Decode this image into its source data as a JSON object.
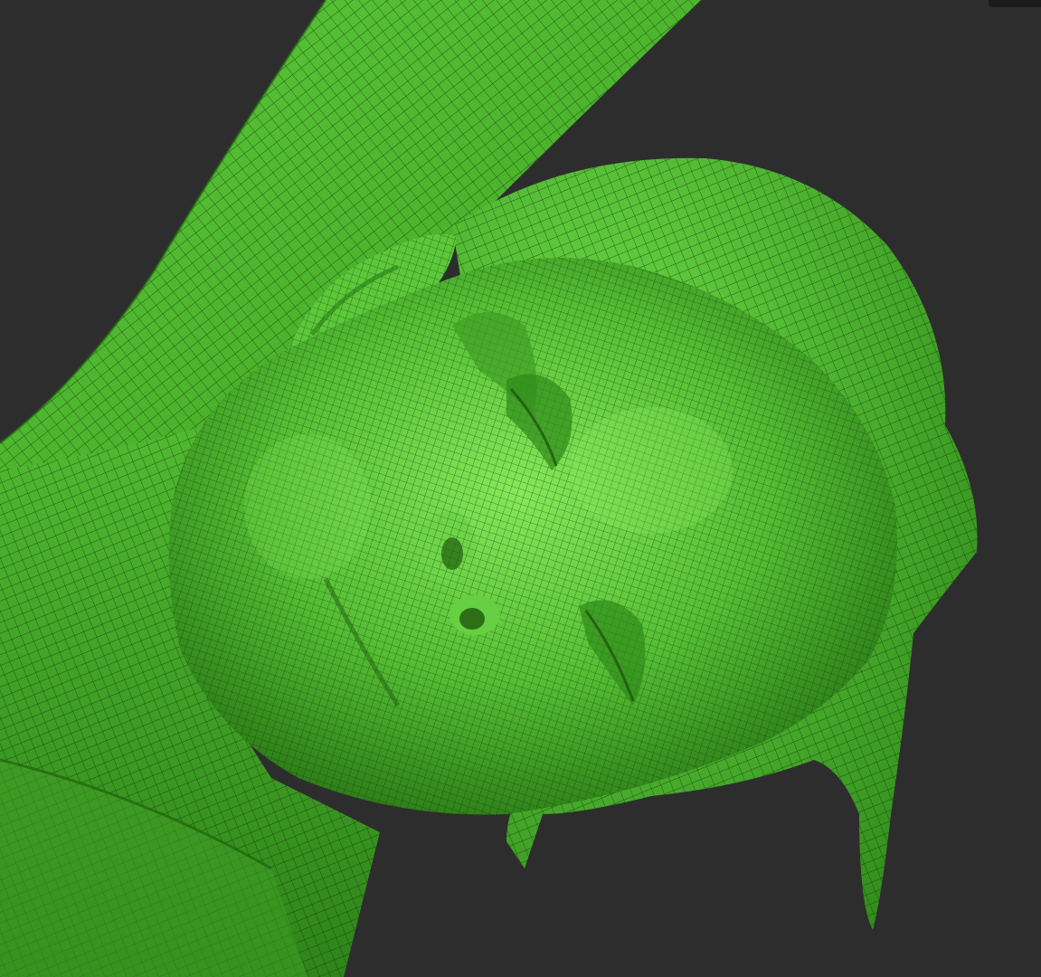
{
  "viewport": {
    "background": "#2d2d2e",
    "display_mode": "polyframe-wireframe-overlay"
  },
  "mesh": {
    "subject": "sculpted-sleeping-figure",
    "material_base": "#4fb830",
    "material_light": "#7de24f",
    "material_shadow": "#226a10",
    "wire_color": "#103808"
  }
}
